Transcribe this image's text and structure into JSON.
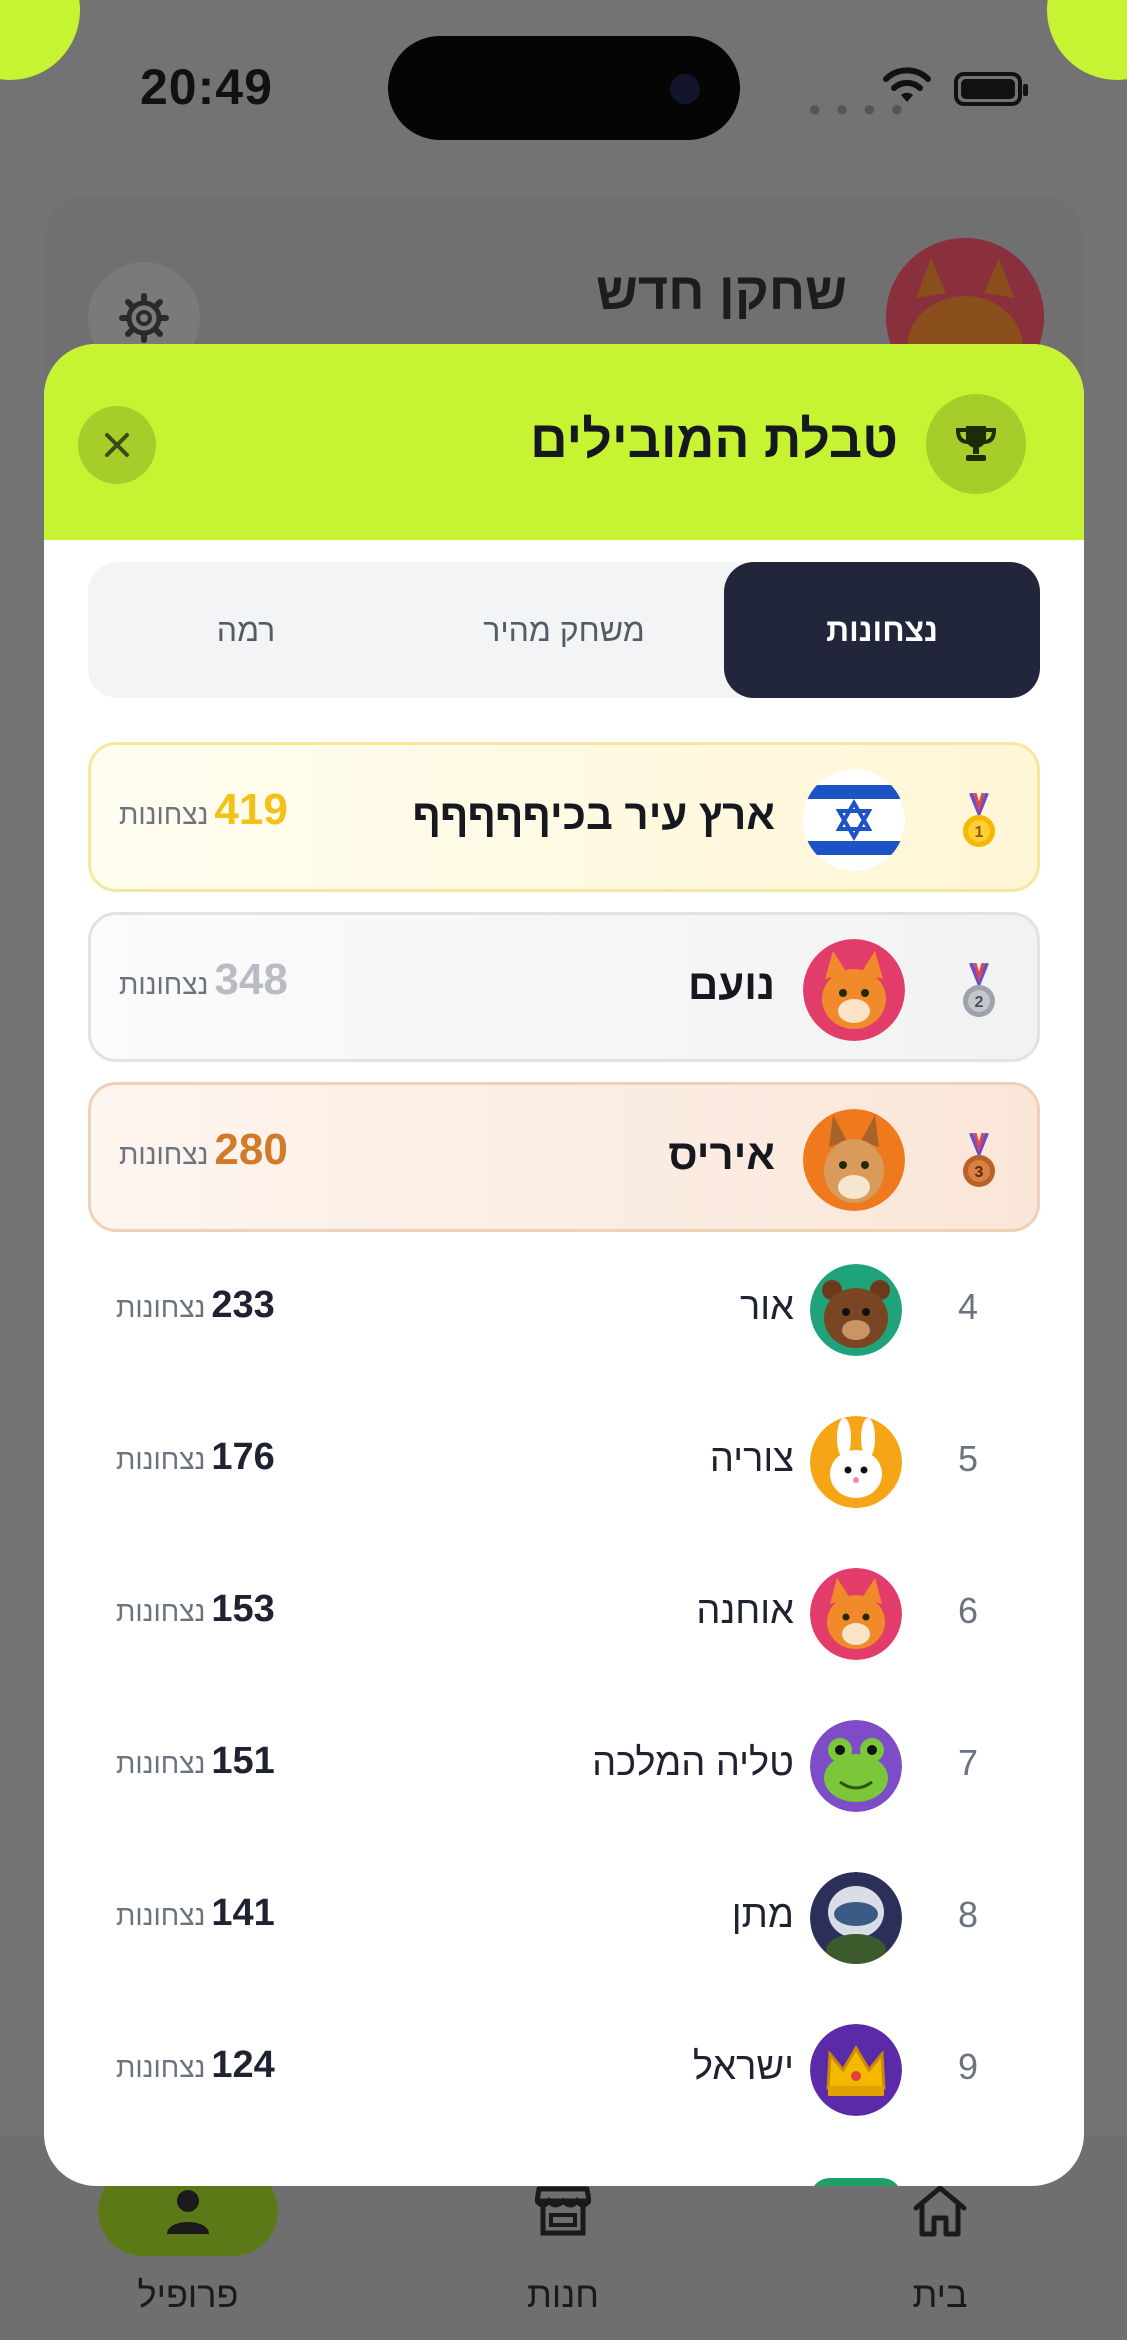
{
  "status_bar": {
    "time": "20:49"
  },
  "profile": {
    "name": "שחקן חדש"
  },
  "leaderboard": {
    "title": "טבלת המובילים",
    "tabs": [
      {
        "label": "נצחונות",
        "active": true
      },
      {
        "label": "משחק מהיר",
        "active": false
      },
      {
        "label": "רמה",
        "active": false
      }
    ],
    "podium": [
      {
        "rank": 1,
        "name": "ארץ עיר בכיףףףףף",
        "score": "419",
        "unit": "נצחונות",
        "avatar_icon": "israel-flag-icon",
        "score_color": "#f2c21b"
      },
      {
        "rank": 2,
        "name": "נועם",
        "score": "348",
        "unit": "נצחונות",
        "avatar_icon": "tiger-icon",
        "score_color": "#b9bcc4"
      },
      {
        "rank": 3,
        "name": "איריס",
        "score": "280",
        "unit": "נצחונות",
        "avatar_icon": "lynx-icon",
        "score_color": "#d07a2a"
      }
    ],
    "rows": [
      {
        "rank": "4",
        "name": "אור",
        "score": "233",
        "unit": "נצחונות",
        "avatar_icon": "bear-icon"
      },
      {
        "rank": "5",
        "name": "צוריה",
        "score": "176",
        "unit": "נצחונות",
        "avatar_icon": "rabbit-icon"
      },
      {
        "rank": "6",
        "name": "אוחנה",
        "score": "153",
        "unit": "נצחונות",
        "avatar_icon": "tiger-icon"
      },
      {
        "rank": "7",
        "name": "טליה המלכה",
        "score": "151",
        "unit": "נצחונות",
        "avatar_icon": "frog-icon"
      },
      {
        "rank": "8",
        "name": "מתן",
        "score": "141",
        "unit": "נצחונות",
        "avatar_icon": "pilot-icon"
      },
      {
        "rank": "9",
        "name": "ישראל",
        "score": "124",
        "unit": "נצחונות",
        "avatar_icon": "crown-icon"
      }
    ]
  },
  "nav": {
    "profile": "פרופיל",
    "store": "חנות",
    "home": "בית"
  },
  "colors": {
    "accent": "#c6f432",
    "tab_active": "#22263a"
  }
}
